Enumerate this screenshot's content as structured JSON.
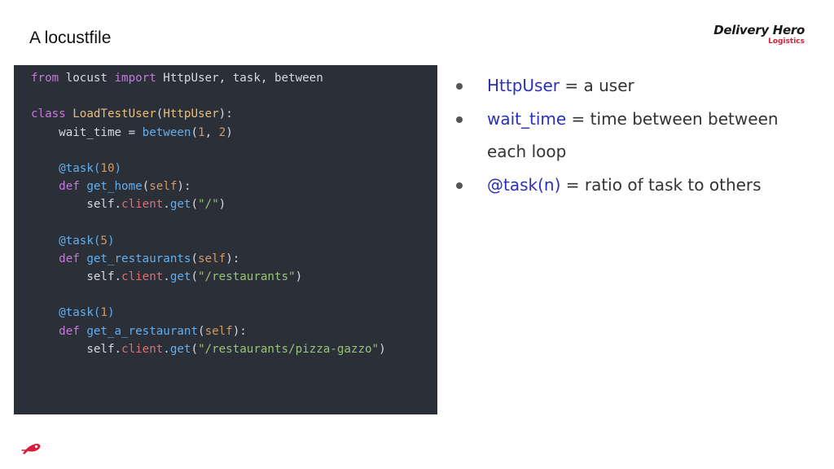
{
  "slide": {
    "title": "A locustfile"
  },
  "brand": {
    "name": "Delivery Hero",
    "sub": "Logistics",
    "accent": "#d61f3a",
    "icon": "dh-logo-icon"
  },
  "code": {
    "lines": [
      [
        {
          "t": "from",
          "c": "k-purple"
        },
        {
          "t": " locust ",
          "c": "k-plain"
        },
        {
          "t": "import",
          "c": "k-purple"
        },
        {
          "t": " HttpUser, task, between",
          "c": "k-plain"
        }
      ],
      [],
      [
        {
          "t": "class",
          "c": "k-purple"
        },
        {
          "t": " ",
          "c": "k-plain"
        },
        {
          "t": "LoadTestUser",
          "c": "k-yellow"
        },
        {
          "t": "(",
          "c": "k-plain"
        },
        {
          "t": "HttpUser",
          "c": "k-yellow"
        },
        {
          "t": "):",
          "c": "k-plain"
        }
      ],
      [
        {
          "t": "    wait_time = ",
          "c": "k-plain"
        },
        {
          "t": "between",
          "c": "k-blue"
        },
        {
          "t": "(",
          "c": "k-plain"
        },
        {
          "t": "1",
          "c": "k-orange"
        },
        {
          "t": ", ",
          "c": "k-plain"
        },
        {
          "t": "2",
          "c": "k-orange"
        },
        {
          "t": ")",
          "c": "k-plain"
        }
      ],
      [],
      [
        {
          "t": "    @task(",
          "c": "k-blue"
        },
        {
          "t": "10",
          "c": "k-orange"
        },
        {
          "t": ")",
          "c": "k-blue"
        }
      ],
      [
        {
          "t": "    def",
          "c": "k-purple"
        },
        {
          "t": " ",
          "c": "k-plain"
        },
        {
          "t": "get_home",
          "c": "k-blue"
        },
        {
          "t": "(",
          "c": "k-plain"
        },
        {
          "t": "self",
          "c": "k-orange"
        },
        {
          "t": "):",
          "c": "k-plain"
        }
      ],
      [
        {
          "t": "        self.",
          "c": "k-plain"
        },
        {
          "t": "client",
          "c": "k-self"
        },
        {
          "t": ".",
          "c": "k-plain"
        },
        {
          "t": "get",
          "c": "k-blue"
        },
        {
          "t": "(",
          "c": "k-plain"
        },
        {
          "t": "\"/\"",
          "c": "k-green"
        },
        {
          "t": ")",
          "c": "k-plain"
        }
      ],
      [],
      [
        {
          "t": "    @task(",
          "c": "k-blue"
        },
        {
          "t": "5",
          "c": "k-orange"
        },
        {
          "t": ")",
          "c": "k-blue"
        }
      ],
      [
        {
          "t": "    def",
          "c": "k-purple"
        },
        {
          "t": " ",
          "c": "k-plain"
        },
        {
          "t": "get_restaurants",
          "c": "k-blue"
        },
        {
          "t": "(",
          "c": "k-plain"
        },
        {
          "t": "self",
          "c": "k-orange"
        },
        {
          "t": "):",
          "c": "k-plain"
        }
      ],
      [
        {
          "t": "        self.",
          "c": "k-plain"
        },
        {
          "t": "client",
          "c": "k-self"
        },
        {
          "t": ".",
          "c": "k-plain"
        },
        {
          "t": "get",
          "c": "k-blue"
        },
        {
          "t": "(",
          "c": "k-plain"
        },
        {
          "t": "\"/restaurants\"",
          "c": "k-green"
        },
        {
          "t": ")",
          "c": "k-plain"
        }
      ],
      [],
      [
        {
          "t": "    @task(",
          "c": "k-blue"
        },
        {
          "t": "1",
          "c": "k-orange"
        },
        {
          "t": ")",
          "c": "k-blue"
        }
      ],
      [
        {
          "t": "    def",
          "c": "k-purple"
        },
        {
          "t": " ",
          "c": "k-plain"
        },
        {
          "t": "get_a_restaurant",
          "c": "k-blue"
        },
        {
          "t": "(",
          "c": "k-plain"
        },
        {
          "t": "self",
          "c": "k-orange"
        },
        {
          "t": "):",
          "c": "k-plain"
        }
      ],
      [
        {
          "t": "        self.",
          "c": "k-plain"
        },
        {
          "t": "client",
          "c": "k-self"
        },
        {
          "t": ".",
          "c": "k-plain"
        },
        {
          "t": "get",
          "c": "k-blue"
        },
        {
          "t": "(",
          "c": "k-plain"
        },
        {
          "t": "\"/restaurants/pizza-gazzo\"",
          "c": "k-green"
        },
        {
          "t": ")",
          "c": "k-plain"
        }
      ]
    ]
  },
  "bullets": [
    {
      "term": "HttpUser",
      "rest": " = a user"
    },
    {
      "term": "wait_time",
      "rest": " = time between between each loop"
    },
    {
      "term": "@task(n)",
      "rest": " = ratio of task to others"
    }
  ]
}
